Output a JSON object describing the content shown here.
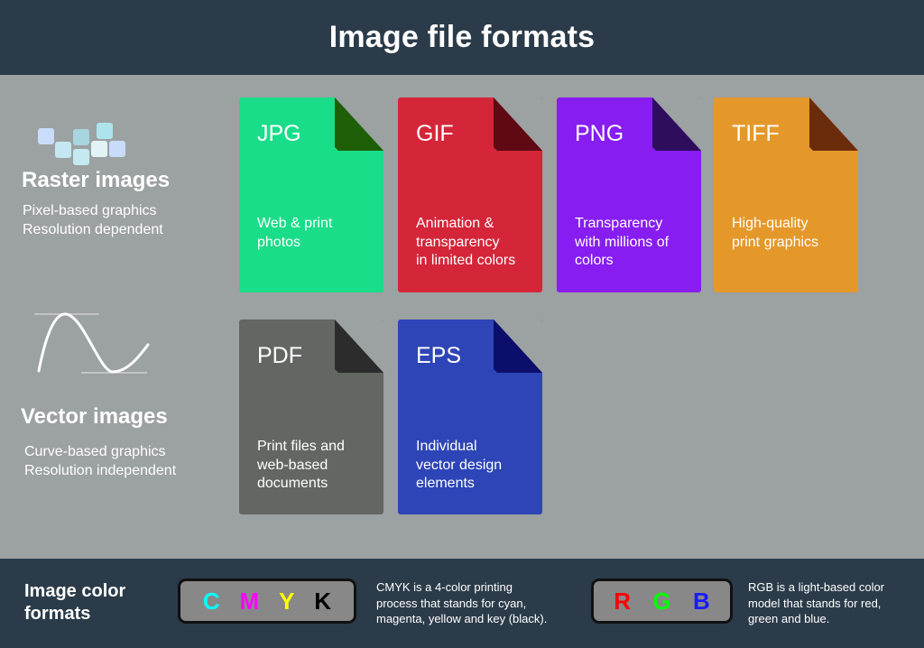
{
  "header": {
    "title": "Image file formats"
  },
  "raster": {
    "title": "Raster images",
    "desc_lines": [
      "Pixel-based graphics",
      "Resolution dependent"
    ],
    "icon": "pixel-grid-icon"
  },
  "vector": {
    "title": "Vector images",
    "desc_lines": [
      "Curve-based graphics",
      "Resolution independent"
    ],
    "icon": "bezier-curve-icon"
  },
  "formats": [
    {
      "name": "JPG",
      "desc_lines": [
        "Web & print",
        "photos"
      ],
      "color": "#19dd88",
      "fold_color": "#1d5e07"
    },
    {
      "name": "GIF",
      "desc_lines": [
        "Animation &",
        "transparency",
        "in limited colors"
      ],
      "color": "#d42539",
      "fold_color": "#5e0914"
    },
    {
      "name": "PNG",
      "desc_lines": [
        "Transparency",
        "with millions of",
        "colors"
      ],
      "color": "#871df1",
      "fold_color": "#2f0d5d"
    },
    {
      "name": "TIFF",
      "desc_lines": [
        "High-quality",
        "print graphics"
      ],
      "color": "#e5982a",
      "fold_color": "#6b2c0b"
    },
    {
      "name": "PDF",
      "desc_lines": [
        "Print files and",
        "web-based",
        "documents"
      ],
      "color": "#646664",
      "fold_color": "#2c2c2c"
    },
    {
      "name": "EPS",
      "desc_lines": [
        "Individual",
        "vector design",
        "elements"
      ],
      "color": "#2d45b6",
      "fold_color": "#0c0e6c"
    }
  ],
  "footer": {
    "title_lines": [
      "Image color",
      "formats"
    ],
    "cmyk": {
      "letters": [
        {
          "char": "C",
          "color": "#00ffff"
        },
        {
          "char": "M",
          "color": "#ff00ff"
        },
        {
          "char": "Y",
          "color": "#ffff00"
        },
        {
          "char": "K",
          "color": "#000000"
        }
      ],
      "desc_lines": [
        "CMYK is a 4-color printing",
        "process that stands for cyan,",
        "magenta, yellow and key (black)."
      ]
    },
    "rgb": {
      "letters": [
        {
          "char": "R",
          "color": "#ff0000"
        },
        {
          "char": "G",
          "color": "#00ff00"
        },
        {
          "char": "B",
          "color": "#1a1aff"
        }
      ],
      "desc_lines": [
        "RGB is a light-based color",
        "model that stands for red,",
        "green and blue."
      ]
    }
  }
}
